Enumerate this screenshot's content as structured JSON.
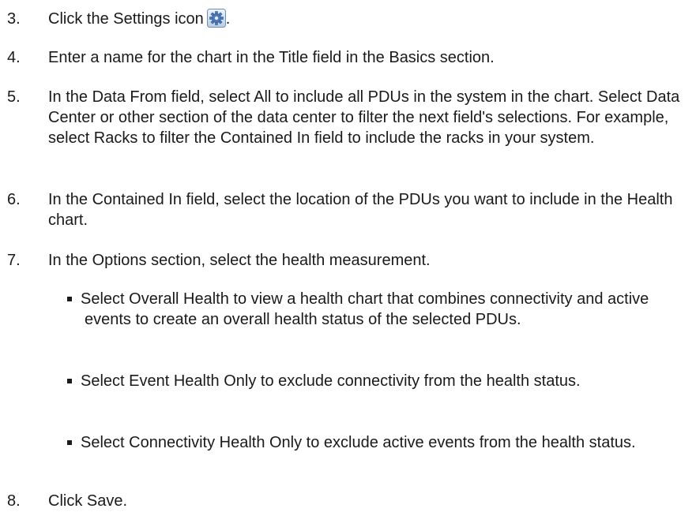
{
  "steps": [
    {
      "number": "3.",
      "text_before": "Click the Settings icon",
      "text_after": ".",
      "icon": "settings-gear-icon"
    },
    {
      "number": "4.",
      "text": "Enter a name for the chart in the Title field in the Basics section."
    },
    {
      "number": "5.",
      "text": "In the Data From field, select All to include all PDUs in the system in the chart. Select Data Center or other section of the data center to filter the next field's selections. For example, select Racks to filter the Contained In field to include the racks in your system."
    },
    {
      "number": "6.",
      "text": "In the Contained In field, select the location of the PDUs you want to include in the Health chart."
    },
    {
      "number": "7.",
      "text": "In the Options section, select the health measurement."
    },
    {
      "number": "8.",
      "text": "Click Save."
    }
  ],
  "options": [
    "Select Overall Health to view a health chart that combines connectivity and active events to create an overall health status of the selected PDUs.",
    "Select Event Health Only to exclude connectivity from the health status.",
    "Select Connectivity Health Only to exclude active events from the health status."
  ]
}
